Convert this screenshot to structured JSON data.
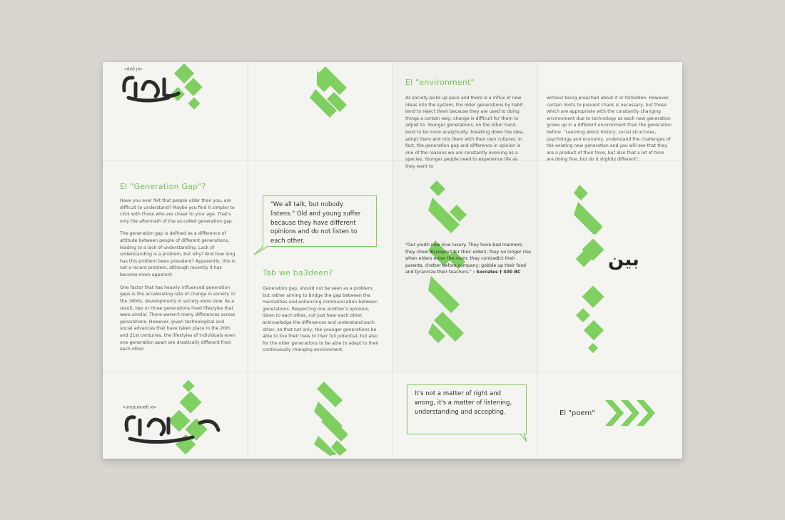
{
  "colors": {
    "green": "#7fcf61",
    "paper": "#f4f4f1",
    "background": "#d9d5cf",
    "ink": "#333333"
  },
  "panel1": {
    "top_label": "«el gap»",
    "heading": "El \"Generation Gap\"?",
    "paragraphs": [
      "Have you ever felt that people older than you, are difficult to understand? Maybe you find it simpler to click with those who are closer to your age. That's only the aftermath of the so-called generation gap.",
      "The generation gap is defined as a difference of attitude between people of different generations, leading to a lack of understanding. Lack of understanding is a problem, but why? And how long has this problem been prevalent? Apparently, this is not a recent problem, although recently it has become more apparent.",
      "One factor that has heavily influenced generation gaps is the accelerating rate of change in society. In the 1800s, developments in society were slow. As a result, two or three generations lived lifestyles that were similar. There weren't many differences across generations. However, given technological and social advances that have taken place in the 20th and 21st centuries, the lifestyles of individuals even one generation apart are drastically different from each other."
    ],
    "bottom_label": "«el generation»"
  },
  "panel2": {
    "quote": "\"We all talk, but nobody listens.\" Old and young suffer because they have different opinions and do not listen to each other.",
    "heading": "Tab we ba3deen?",
    "body": "Generation gap, should not be seen as a problem, but rather aiming to bridge the gap between the mentalities and enhancing communication between generations. Respecting one another's opinions, listen to each other, not just hear each other, acknowledge the differences and understand each other, so that not only; the younger generations be able to live their lives to their full potential, but also for the older generations to be able to adapt to their continuously changing environment."
  },
  "panel3": {
    "heading": "El \"environment\"",
    "body": "As society picks up pace and there is a influx of new ideas into the system, the older generations by habit tend to reject them because they are used to doing things a certain way; change is difficult for them to adjust to. Younger generations, on the other hand, tend to be more analytically; breaking down the idea, adopt them and mix them with their own cultures. In fact, the generation gap and difference in opinion is one of the reasons we are constantly evolving as a species. Younger people need to experience life as they want to",
    "socrates_quote": "\"Our youth now love luxury. They have bad manners, they show disrespect for their elders; they no longer rise when elders enter the room; they contradict their parents, chatter before company; gobble up their food and tyrannize their teachers.\"",
    "socrates_attribution": "- Socrates † 400 BC",
    "bottom_quote": "It's not a matter of right and wrong, it's a matter of listening, understanding and accepting."
  },
  "panel4": {
    "body": "without being preached about it or forbidden. However, certain limits to prevent chaos is necessary, but those which are appropriate with the constantly changing environment due to technology as each new generation grows up in a different environment than the generation before. \"Learning about history, social structures, psychology and economy, understand the challenges of the existing new generation and you will see that they are a product of their time, but also that a lot of time are doing fine, but do it slightly different\".",
    "calligraphy_word": "بين",
    "poem_label": "El \"poem\""
  },
  "calligraphy": {
    "top_left_word": "الفجوة",
    "bottom_left_word": "الجيل"
  }
}
